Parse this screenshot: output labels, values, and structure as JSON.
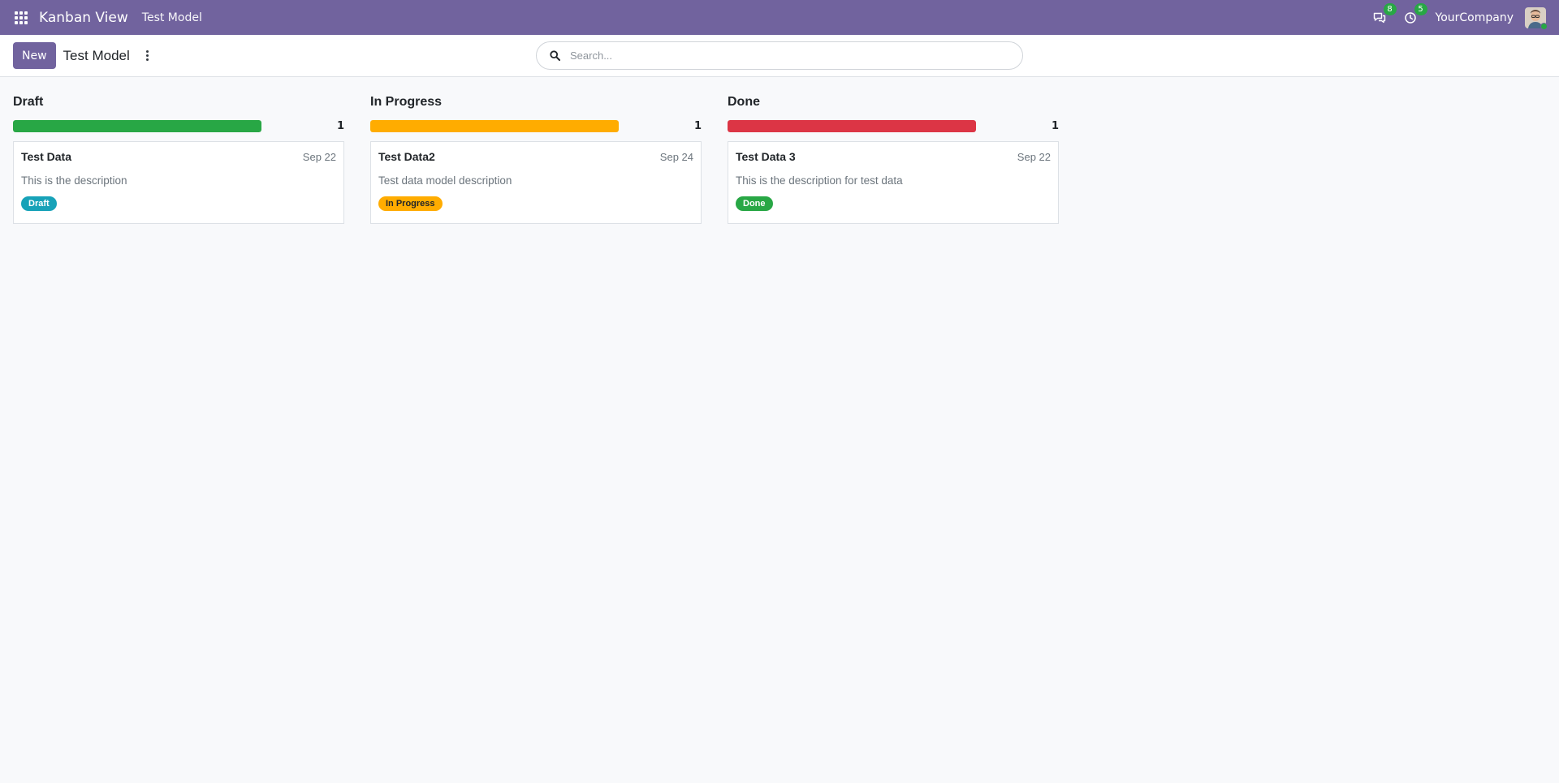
{
  "navbar": {
    "brand": "Kanban View",
    "menu_item": "Test Model",
    "messages_count": "8",
    "activities_count": "5",
    "company": "YourCompany",
    "bg_color": "#71639e"
  },
  "control_panel": {
    "new_label": "New",
    "title": "Test Model",
    "search_placeholder": "Search..."
  },
  "columns": [
    {
      "title": "Draft",
      "count": "1",
      "progress_color": "#28a745",
      "progress_fraction": 1.0,
      "card": {
        "title": "Test Data",
        "date": "Sep 22",
        "description": "This is the description",
        "tag": "Draft",
        "tag_bg": "#17a2b8",
        "tag_fg": "#ffffff"
      }
    },
    {
      "title": "In Progress",
      "count": "1",
      "progress_color": "#ffac00",
      "progress_fraction": 1.0,
      "card": {
        "title": "Test Data2",
        "date": "Sep 24",
        "description": "Test data model description",
        "tag": "In Progress",
        "tag_bg": "#ffac00",
        "tag_fg": "#212529"
      }
    },
    {
      "title": "Done",
      "count": "1",
      "progress_color": "#dc3545",
      "progress_fraction": 1.0,
      "card": {
        "title": "Test Data 3",
        "date": "Sep 22",
        "description": "This is the description for test data",
        "tag": "Done",
        "tag_bg": "#28a745",
        "tag_fg": "#ffffff"
      }
    }
  ]
}
